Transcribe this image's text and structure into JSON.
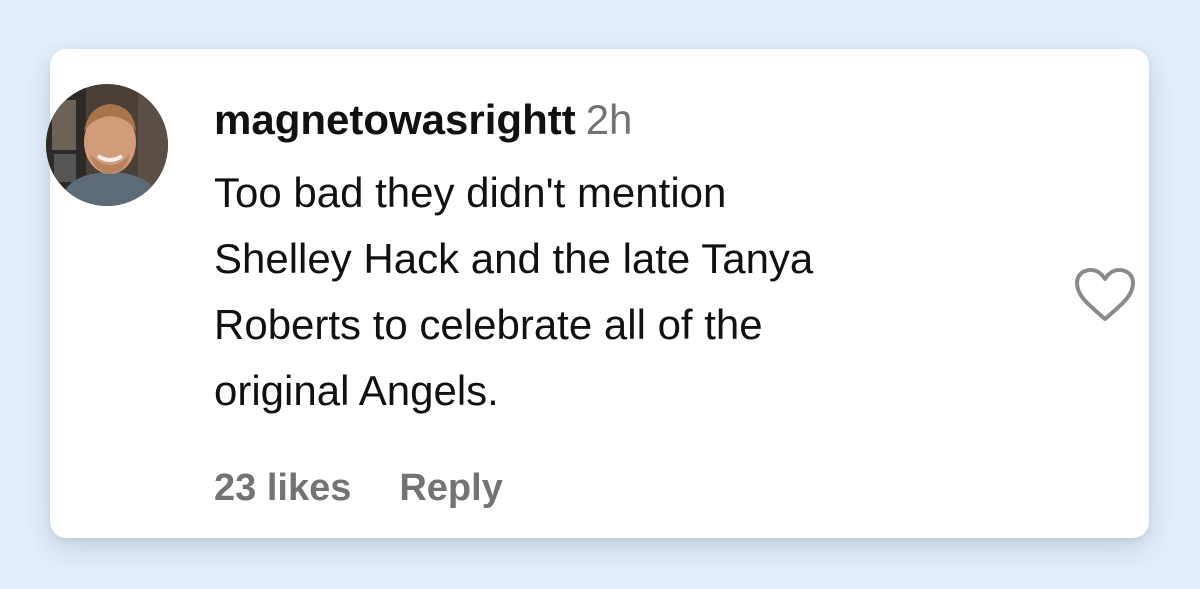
{
  "comment": {
    "username": "magnetowasrightt",
    "time": "2h",
    "lines": [
      "Too bad they didn't mention",
      "Shelley Hack and the late Tanya",
      "Roberts to celebrate all of the",
      "original Angels."
    ],
    "likes": "23 likes",
    "reply_label": "Reply",
    "like_icon": "heart-icon"
  },
  "colors": {
    "background": "#e3effb",
    "card": "#ffffff",
    "text": "#111111",
    "secondary_text": "#737373"
  }
}
